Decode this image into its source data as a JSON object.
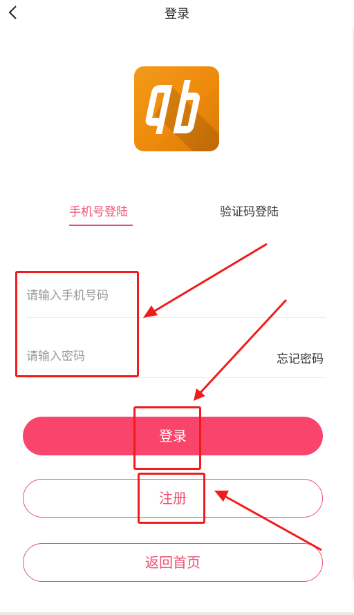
{
  "header": {
    "title": "登录"
  },
  "tabs": [
    {
      "label": "手机号登陆",
      "active": true
    },
    {
      "label": "验证码登陆",
      "active": false
    }
  ],
  "form": {
    "phone_placeholder": "请输入手机号码",
    "phone_value": "",
    "password_placeholder": "请输入密码",
    "password_value": "",
    "forgot_label": "忘记密码"
  },
  "buttons": {
    "login_label": "登录",
    "register_label": "注册",
    "home_label": "返回首页"
  },
  "icons": {
    "back": "chevron-left-icon",
    "logo": "app-logo"
  },
  "colors": {
    "accent": "#ee4d72",
    "login_button": "#f9456b",
    "logo_orange": "#ee8a0b",
    "annotation_red": "#f21a1a"
  }
}
